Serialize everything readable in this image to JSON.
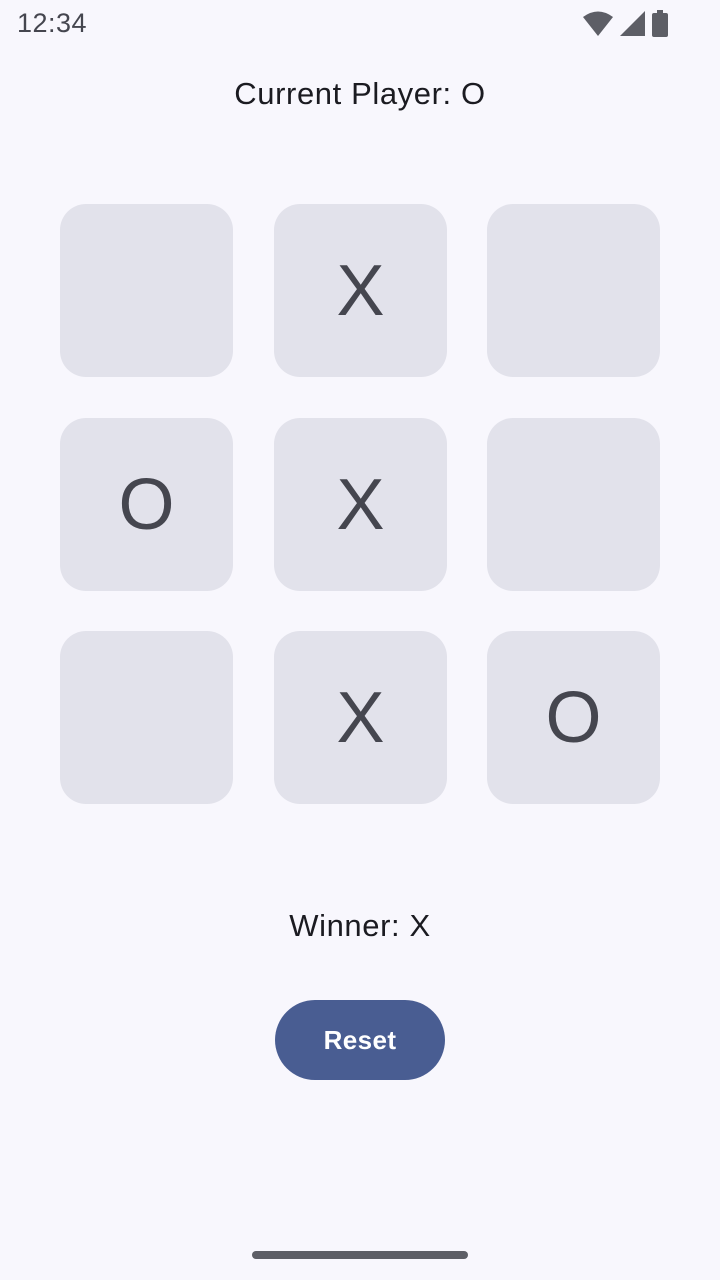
{
  "status_bar": {
    "time": "12:34",
    "icons": [
      "wifi-icon",
      "cellular-signal-icon",
      "battery-icon"
    ]
  },
  "game": {
    "current_player_text": "Current Player: O",
    "board": [
      "",
      "X",
      "",
      "O",
      "X",
      "",
      "",
      "X",
      "O"
    ],
    "winner_text": "Winner: X"
  },
  "controls": {
    "reset_label": "Reset"
  },
  "colors": {
    "background": "#f8f7fd",
    "cell": "#e2e2eb",
    "cell_text": "#45464f",
    "button": "#495d92",
    "button_text": "#ffffff"
  }
}
